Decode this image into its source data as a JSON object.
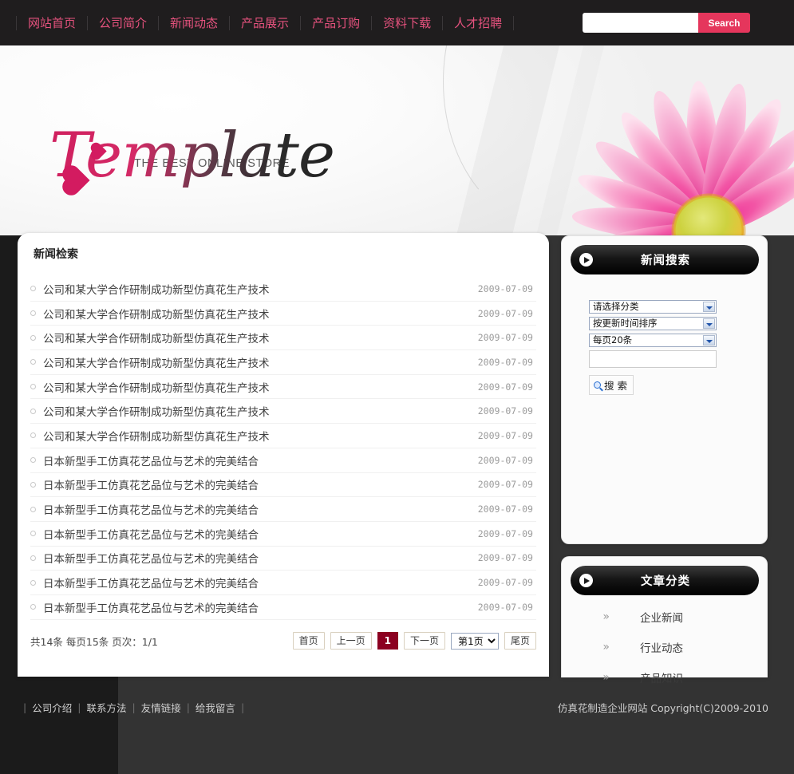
{
  "nav": {
    "items": [
      {
        "label": "网站首页"
      },
      {
        "label": "公司简介"
      },
      {
        "label": "新闻动态"
      },
      {
        "label": "产品展示"
      },
      {
        "label": "产品订购"
      },
      {
        "label": "资料下载"
      },
      {
        "label": "人才招聘"
      }
    ]
  },
  "search": {
    "value": "",
    "placeholder": "",
    "button_label": "Search"
  },
  "logo": {
    "word": "Template",
    "tagline": "THE BEST ONLINE STORE"
  },
  "main": {
    "title": "新闻检索",
    "news": [
      {
        "title": "公司和某大学合作研制成功新型仿真花生产技术",
        "date": "2009-07-09"
      },
      {
        "title": "公司和某大学合作研制成功新型仿真花生产技术",
        "date": "2009-07-09"
      },
      {
        "title": "公司和某大学合作研制成功新型仿真花生产技术",
        "date": "2009-07-09"
      },
      {
        "title": "公司和某大学合作研制成功新型仿真花生产技术",
        "date": "2009-07-09"
      },
      {
        "title": "公司和某大学合作研制成功新型仿真花生产技术",
        "date": "2009-07-09"
      },
      {
        "title": "公司和某大学合作研制成功新型仿真花生产技术",
        "date": "2009-07-09"
      },
      {
        "title": "公司和某大学合作研制成功新型仿真花生产技术",
        "date": "2009-07-09"
      },
      {
        "title": "日本新型手工仿真花艺品位与艺术的完美结合",
        "date": "2009-07-09"
      },
      {
        "title": "日本新型手工仿真花艺品位与艺术的完美结合",
        "date": "2009-07-09"
      },
      {
        "title": "日本新型手工仿真花艺品位与艺术的完美结合",
        "date": "2009-07-09"
      },
      {
        "title": "日本新型手工仿真花艺品位与艺术的完美结合",
        "date": "2009-07-09"
      },
      {
        "title": "日本新型手工仿真花艺品位与艺术的完美结合",
        "date": "2009-07-09"
      },
      {
        "title": "日本新型手工仿真花艺品位与艺术的完美结合",
        "date": "2009-07-09"
      },
      {
        "title": "日本新型手工仿真花艺品位与艺术的完美结合",
        "date": "2009-07-09"
      }
    ]
  },
  "pager": {
    "info": "共14条 每页15条 页次：1/1",
    "first": "首页",
    "prev": "上一页",
    "current": "1",
    "next": "下一页",
    "page_select": "第1页",
    "last": "尾页"
  },
  "sidebar": {
    "search_panel": {
      "title": "新闻搜索",
      "category_select": "请选择分类",
      "sort_select": "按更新时间排序",
      "perpage_select": "每页20条",
      "keyword_value": "",
      "keyword_placeholder": "",
      "search_button": "搜 索"
    },
    "category_panel": {
      "title": "文章分类",
      "chevron": "»",
      "items": [
        {
          "label": "企业新闻"
        },
        {
          "label": "行业动态"
        },
        {
          "label": "产品知识"
        }
      ]
    }
  },
  "footer": {
    "sep": "|",
    "links": [
      {
        "label": "公司介绍"
      },
      {
        "label": "联系方法"
      },
      {
        "label": "友情链接"
      },
      {
        "label": "给我留言"
      }
    ],
    "copyright": "仿真花制造企业网站 Copyright(C)2009-2010"
  },
  "colors": {
    "accent_pink": "#e6527e",
    "search_red": "#e5365c",
    "current_page": "#8c0020",
    "topbar": "#1f1d1e"
  }
}
